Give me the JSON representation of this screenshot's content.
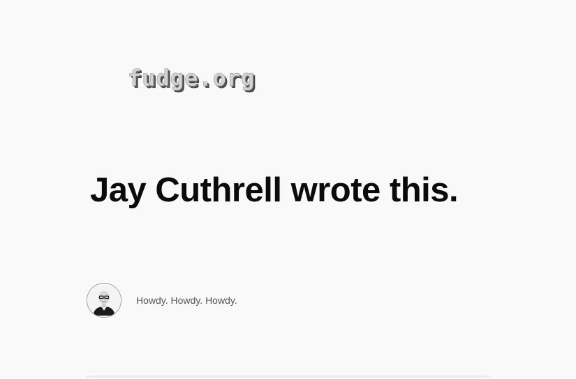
{
  "site": {
    "logo_text": "fudge.org"
  },
  "post": {
    "headline": "Jay Cuthrell wrote this."
  },
  "author": {
    "tagline": "Howdy. Howdy. Howdy."
  },
  "colors": {
    "background": "#f9f9f9",
    "headline": "#0b0b0b",
    "tagline": "#555555",
    "logo_fill": "#d4d4d4",
    "logo_shadow": "#3a3a3a"
  },
  "icons": {
    "avatar": "author-portrait"
  }
}
